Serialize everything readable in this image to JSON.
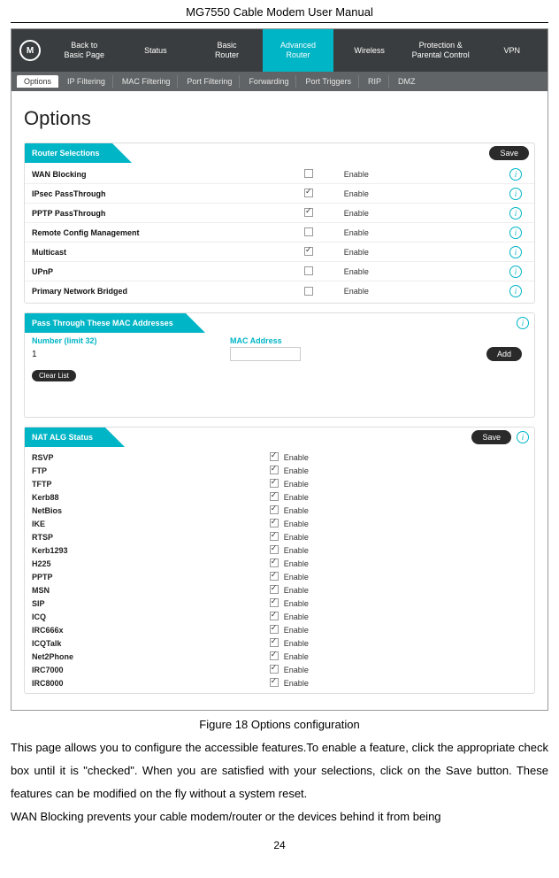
{
  "doc": {
    "header": "MG7550 Cable Modem User Manual",
    "figure_caption": "Figure 18 Options configuration",
    "para1": "This page allows you to configure the accessible features.To enable a feature, click the appropriate check box until it is \"checked\".  When you are satisfied with your selections, click on the Save button.  These features can be modified on the fly without a system reset.",
    "para2": "WAN Blocking prevents your cable modem/router or the devices behind it from being",
    "page_number": "24"
  },
  "nav": {
    "logo_letter": "M",
    "items": [
      {
        "label": "Back to\nBasic Page"
      },
      {
        "label": "Status"
      },
      {
        "label": "Basic\nRouter"
      },
      {
        "label": "Advanced\nRouter",
        "active": true
      },
      {
        "label": "Wireless"
      },
      {
        "label": "Protection &\nParental Control"
      },
      {
        "label": "VPN"
      }
    ]
  },
  "subnav": {
    "items": [
      {
        "label": "Options",
        "active": true
      },
      {
        "label": "IP Filtering"
      },
      {
        "label": "MAC Filtering"
      },
      {
        "label": "Port Filtering"
      },
      {
        "label": "Forwarding"
      },
      {
        "label": "Port Triggers"
      },
      {
        "label": "RIP"
      },
      {
        "label": "DMZ"
      }
    ]
  },
  "page_title": "Options",
  "buttons": {
    "save": "Save",
    "add": "Add",
    "clear_list": "Clear List"
  },
  "enable_label": "Enable",
  "panels": {
    "router_selections": {
      "title": "Router Selections",
      "rows": [
        {
          "name": "WAN Blocking",
          "checked": false
        },
        {
          "name": "IPsec PassThrough",
          "checked": true
        },
        {
          "name": "PPTP PassThrough",
          "checked": true
        },
        {
          "name": "Remote Config Management",
          "checked": false
        },
        {
          "name": "Multicast",
          "checked": true
        },
        {
          "name": "UPnP",
          "checked": false
        },
        {
          "name": "Primary Network Bridged",
          "checked": false
        }
      ]
    },
    "pass_through": {
      "title": "Pass Through These MAC Addresses",
      "col_number": "Number (limit 32)",
      "col_mac": "MAC Address",
      "first_number": "1"
    },
    "nat_alg": {
      "title": "NAT ALG Status",
      "rows": [
        {
          "name": "RSVP",
          "checked": true
        },
        {
          "name": "FTP",
          "checked": true
        },
        {
          "name": "TFTP",
          "checked": true
        },
        {
          "name": "Kerb88",
          "checked": true
        },
        {
          "name": "NetBios",
          "checked": true
        },
        {
          "name": "IKE",
          "checked": true
        },
        {
          "name": "RTSP",
          "checked": true
        },
        {
          "name": "Kerb1293",
          "checked": true
        },
        {
          "name": "H225",
          "checked": true
        },
        {
          "name": "PPTP",
          "checked": true
        },
        {
          "name": "MSN",
          "checked": true
        },
        {
          "name": "SIP",
          "checked": true
        },
        {
          "name": "ICQ",
          "checked": true
        },
        {
          "name": "IRC666x",
          "checked": true
        },
        {
          "name": "ICQTalk",
          "checked": true
        },
        {
          "name": "Net2Phone",
          "checked": true
        },
        {
          "name": "IRC7000",
          "checked": true
        },
        {
          "name": "IRC8000",
          "checked": true
        }
      ]
    }
  }
}
